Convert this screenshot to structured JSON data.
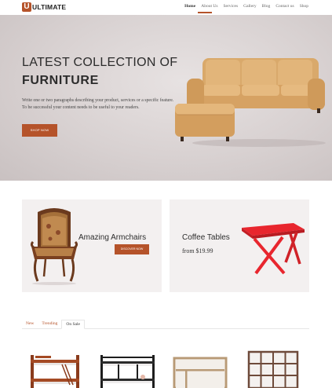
{
  "header": {
    "logo_letter": "U",
    "logo_text": "ULTIMATE",
    "nav": [
      "Home",
      "About Us",
      "Services",
      "Gallery",
      "Blog",
      "Contact us",
      "Shop"
    ],
    "active_nav": "Home"
  },
  "hero": {
    "title_line1": "LATEST COLLECTION OF",
    "title_line2": "FURNITURE",
    "description_line1": "Write one or two paragraphs describing your product, services or a specific feature.",
    "description_line2": "To be successful your content needs to be useful to your readers.",
    "button_label": "SHOP NOW"
  },
  "categories": [
    {
      "title": "Amazing Armchairs",
      "button_label": "DISCOVER NOW"
    },
    {
      "title": "Coffee Tables",
      "price": "from $19.99"
    }
  ],
  "tabs": [
    "New",
    "Trending",
    "On Sale"
  ],
  "active_tab": "On Sale",
  "colors": {
    "accent": "#b5532a",
    "hero_bg": "#d8d1d1",
    "card_bg": "#f3f0f0",
    "table_red": "#e8262e"
  },
  "icons": [
    "bunk-bed-wood-image",
    "bunk-bed-black-image",
    "desk-shelf-image",
    "cube-bookshelf-image"
  ]
}
